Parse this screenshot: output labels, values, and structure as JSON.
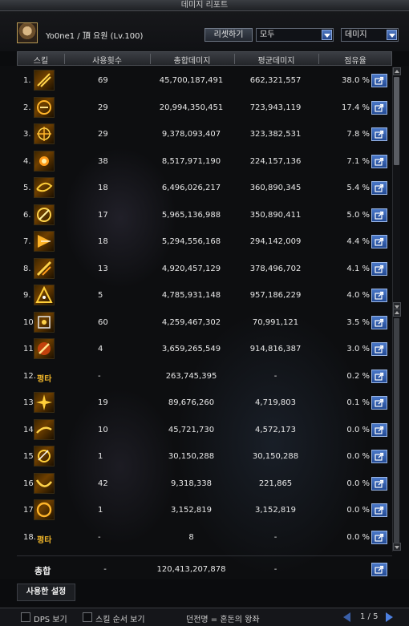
{
  "window": {
    "title": "데미지 리포트",
    "help_label": "?"
  },
  "header": {
    "character": "Yo0ne1 / 頂 요원 (Lv.100)",
    "reset_label": "리셋하기",
    "filter_select": "모두",
    "metric_select": "데미지"
  },
  "columns": {
    "skill": "스킬",
    "count": "사용횟수",
    "total": "총합데미지",
    "avg": "평균데미지",
    "share": "점유율"
  },
  "rows": [
    {
      "idx": "1.",
      "count": "69",
      "total": "45,700,187,491",
      "avg": "662,321,557",
      "share": "38.0 %"
    },
    {
      "idx": "2.",
      "count": "29",
      "total": "20,994,350,451",
      "avg": "723,943,119",
      "share": "17.4 %"
    },
    {
      "idx": "3.",
      "count": "29",
      "total": "9,378,093,407",
      "avg": "323,382,531",
      "share": "7.8 %"
    },
    {
      "idx": "4.",
      "count": "38",
      "total": "8,517,971,190",
      "avg": "224,157,136",
      "share": "7.1 %"
    },
    {
      "idx": "5.",
      "count": "18",
      "total": "6,496,026,217",
      "avg": "360,890,345",
      "share": "5.4 %"
    },
    {
      "idx": "6.",
      "count": "17",
      "total": "5,965,136,988",
      "avg": "350,890,411",
      "share": "5.0 %"
    },
    {
      "idx": "7.",
      "count": "18",
      "total": "5,294,556,168",
      "avg": "294,142,009",
      "share": "4.4 %"
    },
    {
      "idx": "8.",
      "count": "13",
      "total": "4,920,457,129",
      "avg": "378,496,702",
      "share": "4.1 %"
    },
    {
      "idx": "9.",
      "count": "5",
      "total": "4,785,931,148",
      "avg": "957,186,229",
      "share": "4.0 %"
    },
    {
      "idx": "10.",
      "count": "60",
      "total": "4,259,467,302",
      "avg": "70,991,121",
      "share": "3.5 %"
    },
    {
      "idx": "11.",
      "count": "4",
      "total": "3,659,265,549",
      "avg": "914,816,387",
      "share": "3.0 %"
    },
    {
      "idx": "12.",
      "label": "평타",
      "count": "-",
      "total": "263,745,395",
      "avg": "-",
      "share": "0.2 %"
    },
    {
      "idx": "13.",
      "count": "19",
      "total": "89,676,260",
      "avg": "4,719,803",
      "share": "0.1 %"
    },
    {
      "idx": "14.",
      "count": "10",
      "total": "45,721,730",
      "avg": "4,572,173",
      "share": "0.0 %"
    },
    {
      "idx": "15.",
      "count": "1",
      "total": "30,150,288",
      "avg": "30,150,288",
      "share": "0.0 %"
    },
    {
      "idx": "16.",
      "count": "42",
      "total": "9,318,338",
      "avg": "221,865",
      "share": "0.0 %"
    },
    {
      "idx": "17.",
      "count": "1",
      "total": "3,152,819",
      "avg": "3,152,819",
      "share": "0.0 %"
    },
    {
      "idx": "18.",
      "label": "평타",
      "count": "-",
      "total": "8",
      "avg": "-",
      "share": "0.0 %"
    }
  ],
  "total": {
    "label": "총합",
    "count": "-",
    "damage": "120,413,207,878",
    "avg": "-"
  },
  "settings_tab": "사용한 설정",
  "footer": {
    "dps_label": "DPS 보기",
    "skill_order_label": "스킬 순서 보기",
    "dungeon": "던전명 = 혼돈의 왕좌",
    "page": "1 / 5"
  },
  "colors": {
    "accent_blue": "#2e5aa8",
    "gold": "#f1b62a",
    "background": "#0b0c0e"
  }
}
